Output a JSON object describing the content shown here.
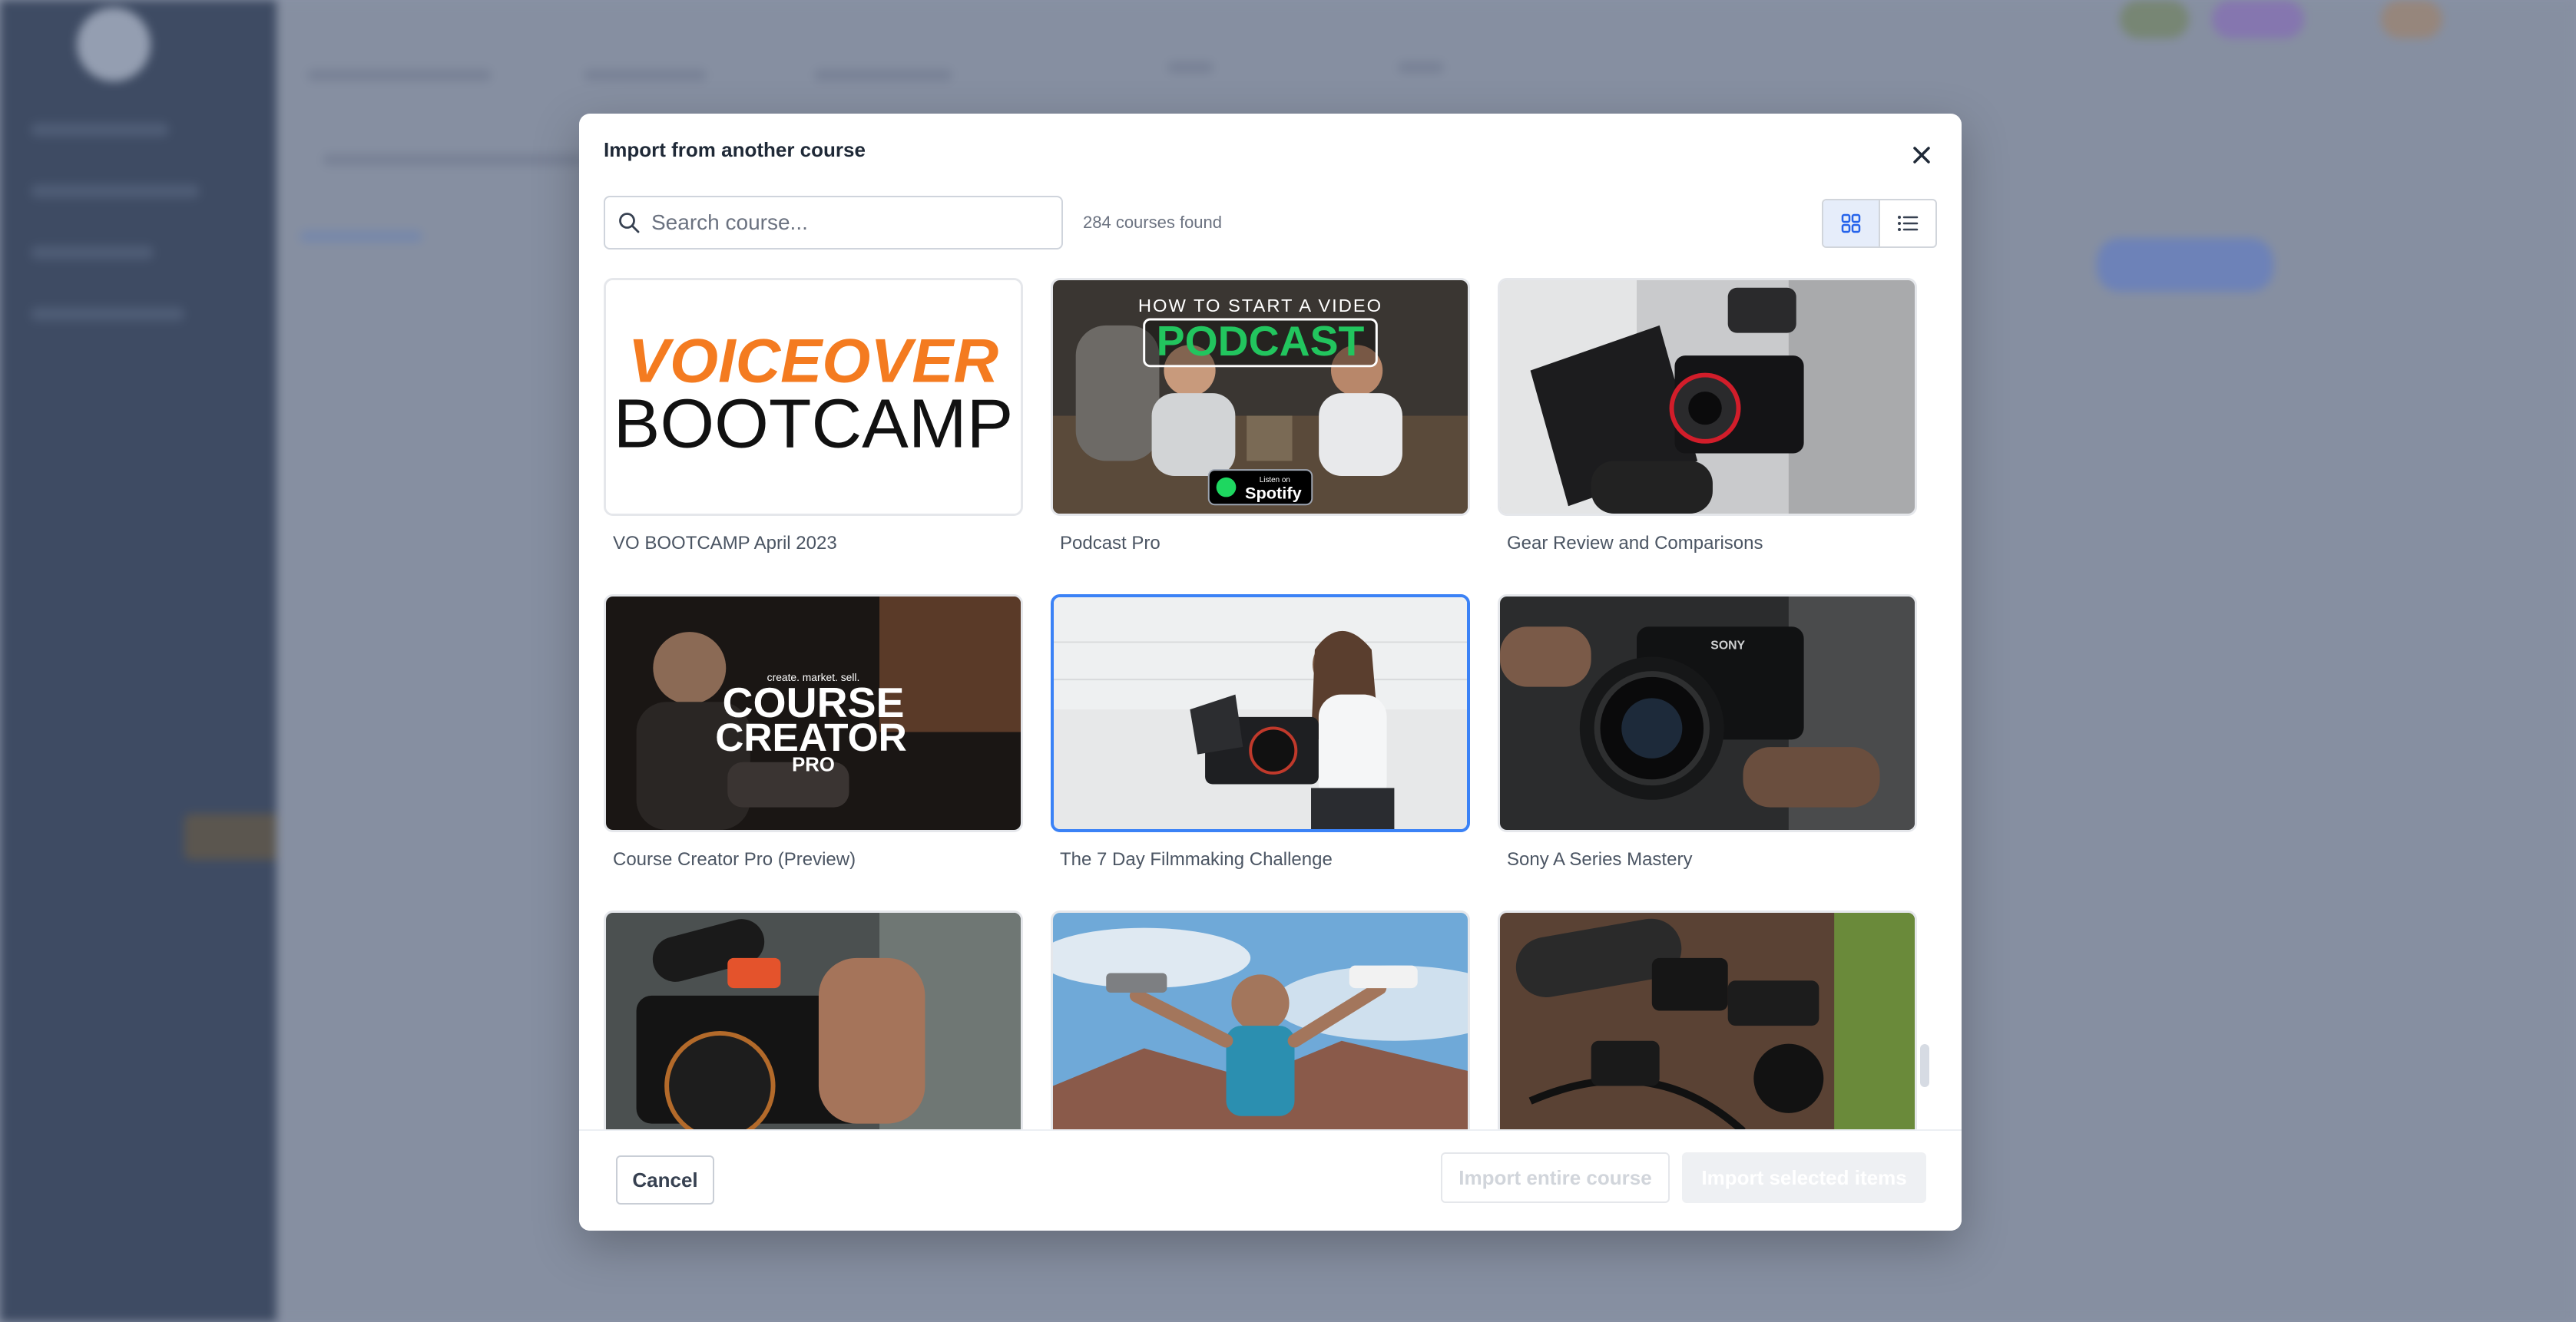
{
  "modal": {
    "title": "Import from another course",
    "search_placeholder": "Search course...",
    "count_text": "284 courses found",
    "view_modes": [
      "grid-icon",
      "list-icon"
    ],
    "active_view": "grid"
  },
  "courses": [
    {
      "title": "VO BOOTCAMP April 2023",
      "thumb_text_1": "VOICEOVER",
      "thumb_text_2": "BOOTCAMP"
    },
    {
      "title": "Podcast Pro",
      "thumb_text_1": "HOW TO START A VIDEO",
      "thumb_text_2": "PODCAST",
      "thumb_badge_small": "Listen on",
      "thumb_badge": "Spotify"
    },
    {
      "title": "Gear Review and Comparisons"
    },
    {
      "title": "Course Creator Pro (Preview)",
      "thumb_text_small": "create. market. sell.",
      "thumb_text_1": "COURSE",
      "thumb_text_2": "CREATOR",
      "thumb_text_3": "PRO"
    },
    {
      "title": "The 7 Day Filmmaking Challenge",
      "selected": true
    },
    {
      "title": "Sony A Series Mastery",
      "thumb_text_1": "SONY"
    },
    {
      "title": ""
    },
    {
      "title": ""
    },
    {
      "title": ""
    }
  ],
  "footer": {
    "cancel_label": "Cancel",
    "import_course_label": "Import entire course",
    "import_items_label": "Import selected items"
  },
  "colors": {
    "accent": "#3b82f6",
    "voiceover_orange": "#f47b20",
    "podcast_green": "#22c55e"
  }
}
